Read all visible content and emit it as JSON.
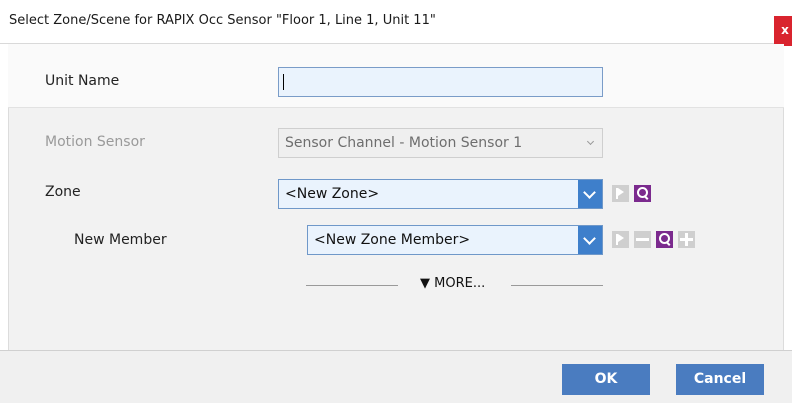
{
  "dialog": {
    "title": "Select Zone/Scene for RAPIX Occ Sensor \"Floor 1, Line 1, Unit 11\"",
    "close_label": "x"
  },
  "form": {
    "unit_name_label": "Unit Name",
    "unit_name_value": "",
    "motion_sensor_label": "Motion Sensor",
    "motion_sensor_value": "Sensor Channel - Motion Sensor 1",
    "zone_label": "Zone",
    "zone_value": "<New Zone>",
    "new_member_label": "New Member",
    "new_member_value": "<New Zone Member>",
    "more_label": "▼ MORE..."
  },
  "footer": {
    "ok_label": "OK",
    "cancel_label": "Cancel"
  },
  "colors": {
    "accent": "#3e7fcb",
    "purple_icon": "#7b2a8e",
    "close_red": "#d9242e"
  },
  "icons": [
    "flag-icon",
    "search-icon",
    "minus-icon",
    "plus-icon",
    "chevron-down-icon"
  ]
}
